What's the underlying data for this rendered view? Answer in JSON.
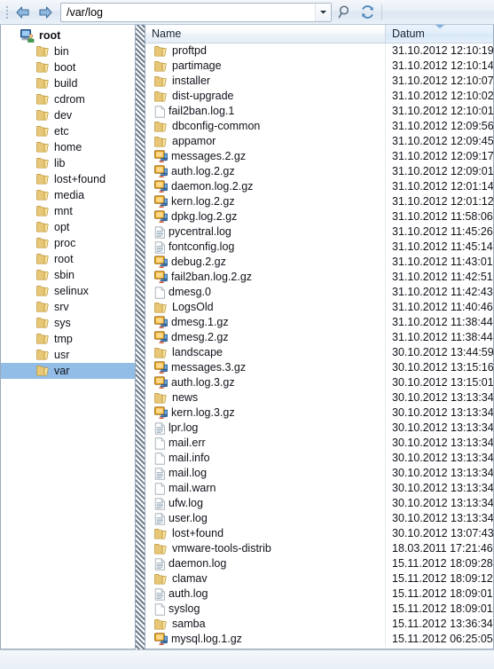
{
  "toolbar": {
    "back_label": "Back",
    "forward_label": "Forward",
    "path_value": "/var/log",
    "path_placeholder": "",
    "dropdown_label": "History",
    "search_label": "Search",
    "refresh_label": "Refresh"
  },
  "tree": {
    "root": {
      "label": "root",
      "icon": "computer-icon"
    },
    "items": [
      {
        "label": "bin",
        "selected": false
      },
      {
        "label": "boot",
        "selected": false
      },
      {
        "label": "build",
        "selected": false
      },
      {
        "label": "cdrom",
        "selected": false
      },
      {
        "label": "dev",
        "selected": false
      },
      {
        "label": "etc",
        "selected": false
      },
      {
        "label": "home",
        "selected": false
      },
      {
        "label": "lib",
        "selected": false
      },
      {
        "label": "lost+found",
        "selected": false
      },
      {
        "label": "media",
        "selected": false
      },
      {
        "label": "mnt",
        "selected": false
      },
      {
        "label": "opt",
        "selected": false
      },
      {
        "label": "proc",
        "selected": false
      },
      {
        "label": "root",
        "selected": false
      },
      {
        "label": "sbin",
        "selected": false
      },
      {
        "label": "selinux",
        "selected": false
      },
      {
        "label": "srv",
        "selected": false
      },
      {
        "label": "sys",
        "selected": false
      },
      {
        "label": "tmp",
        "selected": false
      },
      {
        "label": "usr",
        "selected": false
      },
      {
        "label": "var",
        "selected": true
      }
    ]
  },
  "filelist": {
    "columns": [
      {
        "key": "name",
        "label": "Name",
        "sorted": false
      },
      {
        "key": "datum",
        "label": "Datum",
        "sorted": true,
        "sort_direction": "desc"
      }
    ],
    "rows": [
      {
        "name": "proftpd",
        "icon": "folder-icon",
        "datum": "31.10.2012 12:10:19"
      },
      {
        "name": "partimage",
        "icon": "folder-icon",
        "datum": "31.10.2012 12:10:14"
      },
      {
        "name": "installer",
        "icon": "folder-icon",
        "datum": "31.10.2012 12:10:07"
      },
      {
        "name": "dist-upgrade",
        "icon": "folder-icon",
        "datum": "31.10.2012 12:10:02"
      },
      {
        "name": "fail2ban.log.1",
        "icon": "file-icon",
        "datum": "31.10.2012 12:10:01"
      },
      {
        "name": "dbconfig-common",
        "icon": "folder-icon",
        "datum": "31.10.2012 12:09:56"
      },
      {
        "name": "appamor",
        "icon": "folder-icon",
        "datum": "31.10.2012 12:09:45"
      },
      {
        "name": "messages.2.gz",
        "icon": "archive-icon",
        "datum": "31.10.2012 12:09:17"
      },
      {
        "name": "auth.log.2.gz",
        "icon": "archive-icon",
        "datum": "31.10.2012 12:09:01"
      },
      {
        "name": "daemon.log.2.gz",
        "icon": "archive-icon",
        "datum": "31.10.2012 12:01:14"
      },
      {
        "name": "kern.log.2.gz",
        "icon": "archive-icon",
        "datum": "31.10.2012 12:01:12"
      },
      {
        "name": "dpkg.log.2.gz",
        "icon": "archive-icon",
        "datum": "31.10.2012 11:58:06"
      },
      {
        "name": "pycentral.log",
        "icon": "text-icon",
        "datum": "31.10.2012 11:45:26"
      },
      {
        "name": "fontconfig.log",
        "icon": "text-icon",
        "datum": "31.10.2012 11:45:14"
      },
      {
        "name": "debug.2.gz",
        "icon": "archive-icon",
        "datum": "31.10.2012 11:43:01"
      },
      {
        "name": "fail2ban.log.2.gz",
        "icon": "archive-icon",
        "datum": "31.10.2012 11:42:51"
      },
      {
        "name": "dmesg.0",
        "icon": "file-icon",
        "datum": "31.10.2012 11:42:43"
      },
      {
        "name": "LogsOld",
        "icon": "folder-icon",
        "datum": "31.10.2012 11:40:46"
      },
      {
        "name": "dmesg.1.gz",
        "icon": "archive-icon",
        "datum": "31.10.2012 11:38:44"
      },
      {
        "name": "dmesg.2.gz",
        "icon": "archive-icon",
        "datum": "31.10.2012 11:38:44"
      },
      {
        "name": "landscape",
        "icon": "folder-icon",
        "datum": "30.10.2012 13:44:59"
      },
      {
        "name": "messages.3.gz",
        "icon": "archive-icon",
        "datum": "30.10.2012 13:15:16"
      },
      {
        "name": "auth.log.3.gz",
        "icon": "archive-icon",
        "datum": "30.10.2012 13:15:01"
      },
      {
        "name": "news",
        "icon": "folder-icon",
        "datum": "30.10.2012 13:13:34"
      },
      {
        "name": "kern.log.3.gz",
        "icon": "archive-icon",
        "datum": "30.10.2012 13:13:34"
      },
      {
        "name": "lpr.log",
        "icon": "text-icon",
        "datum": "30.10.2012 13:13:34"
      },
      {
        "name": "mail.err",
        "icon": "file-icon",
        "datum": "30.10.2012 13:13:34"
      },
      {
        "name": "mail.info",
        "icon": "file-icon",
        "datum": "30.10.2012 13:13:34"
      },
      {
        "name": "mail.log",
        "icon": "text-icon",
        "datum": "30.10.2012 13:13:34"
      },
      {
        "name": "mail.warn",
        "icon": "file-icon",
        "datum": "30.10.2012 13:13:34"
      },
      {
        "name": "ufw.log",
        "icon": "text-icon",
        "datum": "30.10.2012 13:13:34"
      },
      {
        "name": "user.log",
        "icon": "text-icon",
        "datum": "30.10.2012 13:13:34"
      },
      {
        "name": "lost+found",
        "icon": "folder-icon",
        "datum": "30.10.2012 13:07:43"
      },
      {
        "name": "vmware-tools-distrib",
        "icon": "folder-icon",
        "datum": "18.03.2011 17:21:46"
      },
      {
        "name": "daemon.log",
        "icon": "text-icon",
        "datum": "15.11.2012 18:09:28"
      },
      {
        "name": "clamav",
        "icon": "folder-icon",
        "datum": "15.11.2012 18:09:12"
      },
      {
        "name": "auth.log",
        "icon": "text-icon",
        "datum": "15.11.2012 18:09:01"
      },
      {
        "name": "syslog",
        "icon": "file-icon",
        "datum": "15.11.2012 18:09:01"
      },
      {
        "name": "samba",
        "icon": "folder-icon",
        "datum": "15.11.2012 13:36:34"
      },
      {
        "name": "mysql.log.1.gz",
        "icon": "archive-icon",
        "datum": "15.11.2012 06:25:05"
      }
    ]
  },
  "statusbar": {
    "text": ""
  },
  "colors": {
    "selection": "#92bde7",
    "folder": "#f5d98b",
    "accent": "#7fb2df",
    "pane_border": "#9aa9bb"
  }
}
